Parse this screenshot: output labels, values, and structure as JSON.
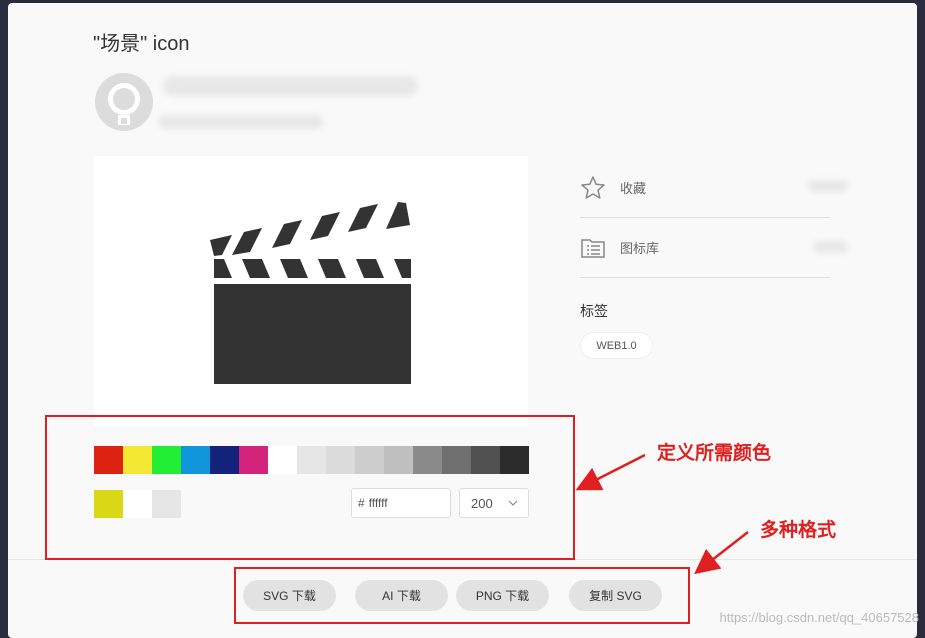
{
  "dialog": {
    "title": "\"场景\" icon"
  },
  "side": {
    "favorite_label": "收藏",
    "library_label": "图标库",
    "tags_title": "标签",
    "tags": [
      "WEB1.0"
    ]
  },
  "palette": {
    "colors": [
      "#dd2211",
      "#f5e832",
      "#22ee33",
      "#1296db",
      "#13227a",
      "#d4237a",
      "#ffffff",
      "#e6e6e6",
      "#dbdbdb",
      "#cdcdcd",
      "#bfbfbf",
      "#8a8a8a",
      "#707070",
      "#515151",
      "#2c2c2c"
    ],
    "recent_colors": [
      "#d8d817",
      "#ffffff",
      "#e6e6e6"
    ],
    "hex_prefix": "#",
    "hex_value": "ffffff",
    "size_value": "200",
    "icon_color": "#333333"
  },
  "buttons": {
    "svg_download": "SVG 下载",
    "ai_download": "AI 下载",
    "png_download": "PNG 下载",
    "copy_svg": "复制 SVG"
  },
  "annotations": {
    "colors_note": "定义所需颜色",
    "formats_note": "多种格式",
    "accent": "#e02020"
  },
  "watermark": "https://blog.csdn.net/qq_40657528"
}
